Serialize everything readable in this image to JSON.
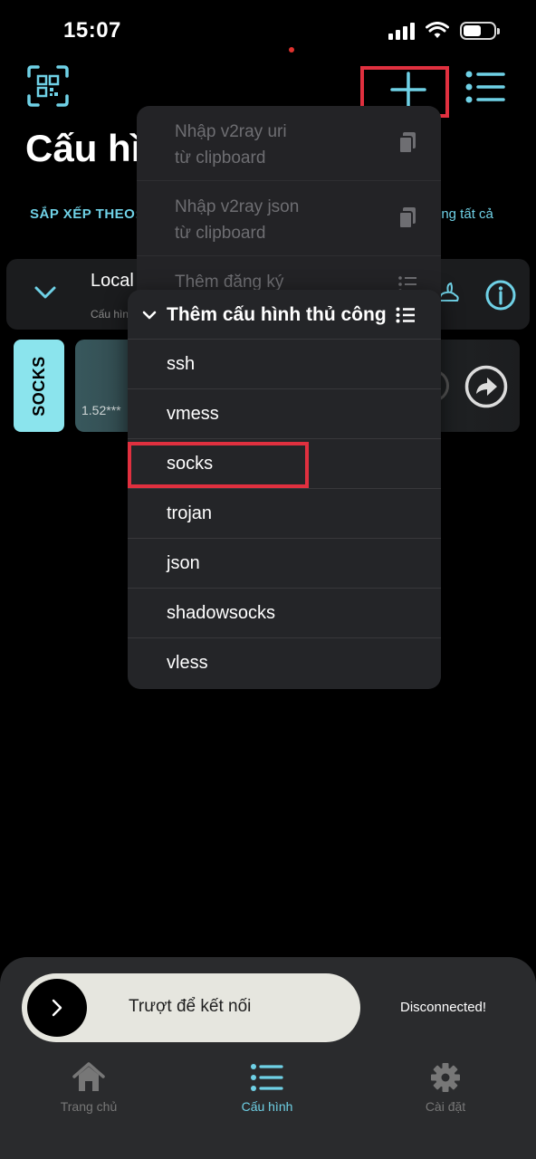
{
  "status_bar": {
    "time": "15:07"
  },
  "header": {
    "title": "Cấu hình",
    "sort_label": "SẮP XẾP THEO:",
    "sort_right": "ing tất cả"
  },
  "group": {
    "name": "Local",
    "subtitle": "Cấu hìn"
  },
  "config": {
    "protocol": "SOCKS",
    "address": "1.52***"
  },
  "dropdown": {
    "items": [
      {
        "line1": "Nhập v2ray uri",
        "line2": "từ clipboard",
        "icon": "clipboard-icon"
      },
      {
        "line1": "Nhập v2ray json",
        "line2": "từ clipboard",
        "icon": "clipboard-icon"
      },
      {
        "line1": "Thêm đăng ký",
        "line2": "",
        "icon": "list-icon"
      }
    ]
  },
  "submenu": {
    "title": "Thêm cấu hình thủ công",
    "items": [
      "ssh",
      "vmess",
      "socks",
      "trojan",
      "json",
      "shadowsocks",
      "vless"
    ],
    "highlighted": "socks"
  },
  "bottom": {
    "slider_text": "Trượt để kết nối",
    "status": "Disconnected!",
    "tabs": [
      {
        "label": "Trang chủ",
        "icon": "home-icon",
        "active": false
      },
      {
        "label": "Cấu hình",
        "icon": "list-icon",
        "active": true
      },
      {
        "label": "Cài đặt",
        "icon": "gear-icon",
        "active": false
      }
    ]
  },
  "colors": {
    "accent": "#6fd1e6",
    "highlight": "#e0303f",
    "tag": "#8be4ed"
  }
}
